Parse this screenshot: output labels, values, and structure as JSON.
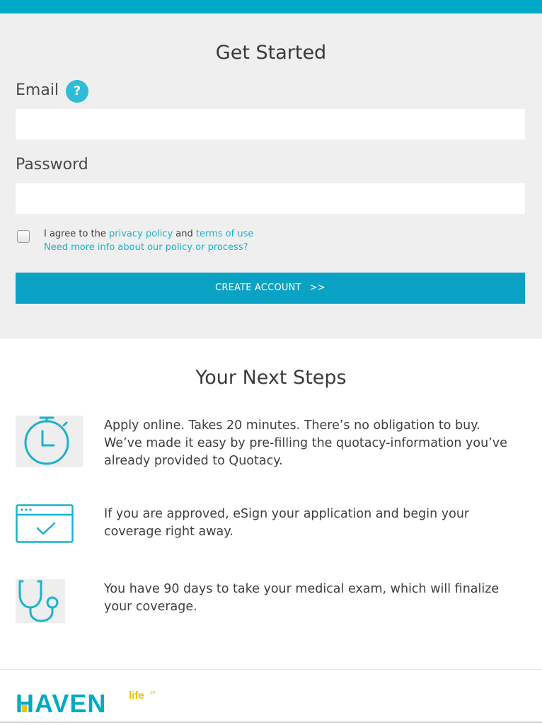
{
  "form": {
    "title": "Get Started",
    "email_label": "Email",
    "help_glyph": "?",
    "email_value": "",
    "password_label": "Password",
    "password_value": "",
    "agree_prefix": "I agree to the",
    "privacy_link": "privacy policy",
    "agree_and": "and",
    "terms_link": "terms of use",
    "info_link": "Need more info about our policy or process?",
    "agree_checked": false,
    "create_button": "CREATE ACCOUNT",
    "create_arrows": ">>"
  },
  "steps": {
    "title": "Your Next Steps",
    "items": [
      {
        "icon": "stopwatch-icon",
        "text": "Apply online. Takes 20 minutes. There’s no obligation to buy. We’ve made it easy by pre-filling the quotacy-information you’ve already provided to Quotacy."
      },
      {
        "icon": "browser-check-icon",
        "text": "If you are approved, eSign your application and begin your coverage right away."
      },
      {
        "icon": "stethoscope-icon",
        "text": "You have 90 days to take your medical exam, which will finalize your coverage."
      }
    ]
  },
  "footer": {
    "logo_main": "HAVEN",
    "logo_sub": "life",
    "logo_mark": "SM"
  },
  "colors": {
    "accent": "#00a9c6",
    "button": "#0aa2c4",
    "link": "#1ab2cc",
    "logo_yellow": "#f2c200"
  }
}
